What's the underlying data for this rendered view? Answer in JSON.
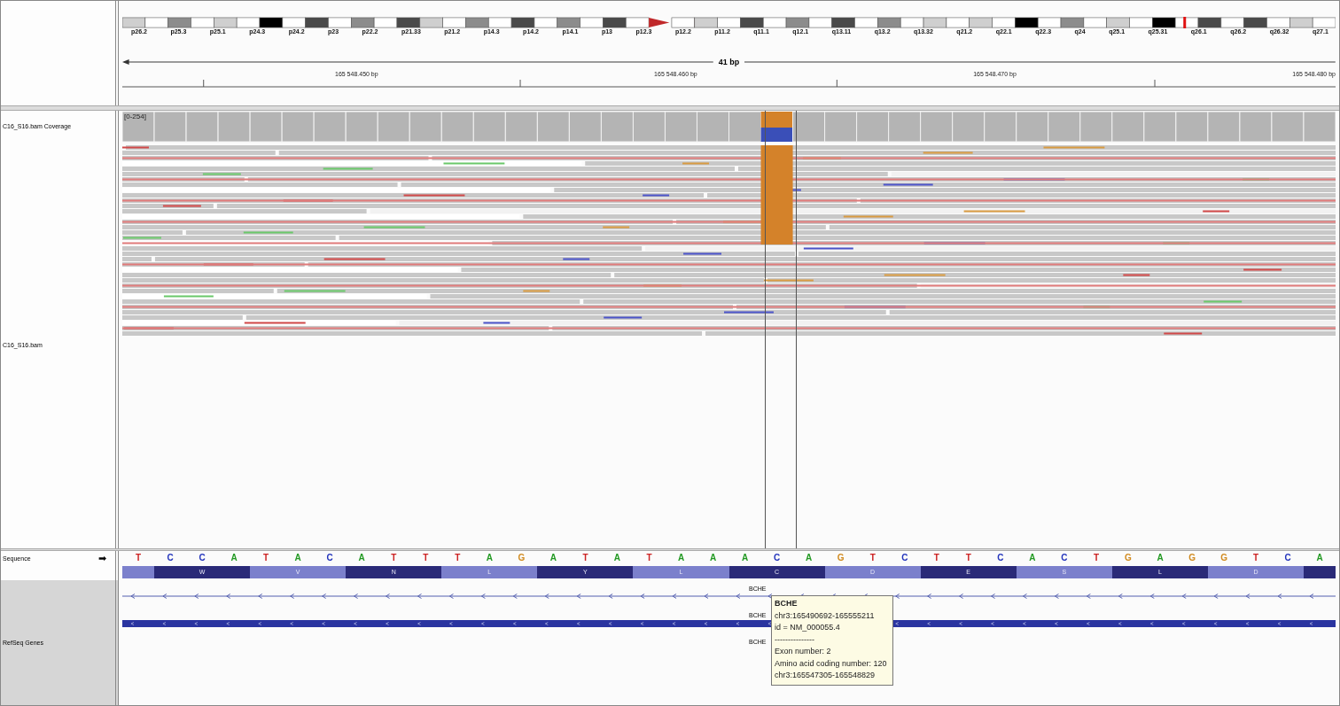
{
  "cytobands": [
    "p26.2",
    "p25.3",
    "p25.1",
    "p24.3",
    "p24.2",
    "p23",
    "p22.2",
    "p21.33",
    "p21.2",
    "p14.3",
    "p14.2",
    "p14.1",
    "p13",
    "p12.3",
    "p12.2",
    "p11.2",
    "q11.1",
    "q12.1",
    "q13.11",
    "q13.2",
    "q13.32",
    "q21.2",
    "q22.1",
    "q22.3",
    "q24",
    "q25.1",
    "q25.31",
    "q26.1",
    "q26.2",
    "q26.32",
    "q27.1"
  ],
  "ruler": {
    "span": "41 bp",
    "positions": [
      "165 548.450 bp",
      "165 548.460 bp",
      "165 548.470 bp",
      "165 548.480 bp"
    ]
  },
  "coverage": {
    "name": "C16_S16.bam Coverage",
    "range": "[0-254]"
  },
  "alignment": {
    "name": "C16_S16.bam"
  },
  "sequence": {
    "name": "Sequence",
    "arrow": "➡",
    "bases": [
      {
        "base": "T",
        "color": "#cc2222",
        "highlighted": false
      },
      {
        "base": "C",
        "color": "#2233bb",
        "highlighted": false
      },
      {
        "base": "C",
        "color": "#2233bb",
        "highlighted": false
      },
      {
        "base": "A",
        "color": "#229922",
        "highlighted": false
      },
      {
        "base": "T",
        "color": "#cc2222",
        "highlighted": false
      },
      {
        "base": "A",
        "color": "#229922",
        "highlighted": false
      },
      {
        "base": "C",
        "color": "#2233bb",
        "highlighted": false
      },
      {
        "base": "A",
        "color": "#229922",
        "highlighted": false
      },
      {
        "base": "T",
        "color": "#cc2222",
        "highlighted": false
      },
      {
        "base": "T",
        "color": "#cc2222",
        "highlighted": false
      },
      {
        "base": "T",
        "color": "#cc2222",
        "highlighted": false
      },
      {
        "base": "A",
        "color": "#229922",
        "highlighted": false
      },
      {
        "base": "G",
        "color": "#d18a1e",
        "highlighted": false
      },
      {
        "base": "A",
        "color": "#229922",
        "highlighted": false
      },
      {
        "base": "T",
        "color": "#cc2222",
        "highlighted": false
      },
      {
        "base": "A",
        "color": "#229922",
        "highlighted": false
      },
      {
        "base": "T",
        "color": "#cc2222",
        "highlighted": false
      },
      {
        "base": "A",
        "color": "#229922",
        "highlighted": false
      },
      {
        "base": "A",
        "color": "#229922",
        "highlighted": false
      },
      {
        "base": "A",
        "color": "#229922",
        "highlighted": false
      },
      {
        "base": "C",
        "color": "#2233bb",
        "highlighted": true
      },
      {
        "base": "A",
        "color": "#229922",
        "highlighted": false
      },
      {
        "base": "G",
        "color": "#d18a1e",
        "highlighted": false
      },
      {
        "base": "T",
        "color": "#cc2222",
        "highlighted": false
      },
      {
        "base": "C",
        "color": "#2233bb",
        "highlighted": false
      },
      {
        "base": "T",
        "color": "#cc2222",
        "highlighted": false
      },
      {
        "base": "T",
        "color": "#cc2222",
        "highlighted": false
      },
      {
        "base": "C",
        "color": "#2233bb",
        "highlighted": false
      },
      {
        "base": "A",
        "color": "#229922",
        "highlighted": false
      },
      {
        "base": "C",
        "color": "#2233bb",
        "highlighted": false
      },
      {
        "base": "T",
        "color": "#cc2222",
        "highlighted": false
      },
      {
        "base": "G",
        "color": "#d18a1e",
        "highlighted": false
      },
      {
        "base": "A",
        "color": "#229922",
        "highlighted": false
      },
      {
        "base": "G",
        "color": "#d18a1e",
        "highlighted": false
      },
      {
        "base": "G",
        "color": "#d18a1e",
        "highlighted": false
      },
      {
        "base": "T",
        "color": "#cc2222",
        "highlighted": false
      },
      {
        "base": "C",
        "color": "#2233bb",
        "highlighted": false
      },
      {
        "base": "A",
        "color": "#229922",
        "highlighted": false
      }
    ]
  },
  "translation": [
    "W",
    "V",
    "N",
    "L",
    "Y",
    "L",
    "C",
    "D",
    "E",
    "S",
    "L",
    "D"
  ],
  "genes": {
    "name": "RefSeq Genes",
    "features": [
      {
        "label": "BCHE",
        "kind": "thin"
      },
      {
        "label": "BCHE",
        "kind": "thick"
      },
      {
        "label": "BCHE",
        "kind": "label"
      }
    ]
  },
  "tooltip": {
    "title": "BCHE",
    "lines": [
      "chr3:165490692-165555211",
      "id = NM_000055.4",
      "---------------",
      "Exon number: 2",
      "Amino acid coding number: 120",
      "chr3:165547305-165548829"
    ]
  }
}
